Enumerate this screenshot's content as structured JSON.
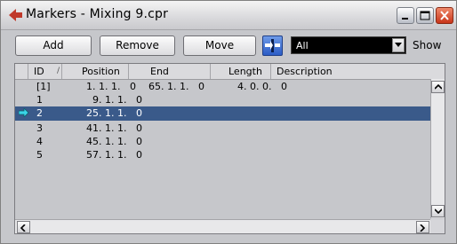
{
  "window": {
    "title": "Markers - Mixing 9.cpr"
  },
  "toolbar": {
    "add_label": "Add",
    "remove_label": "Remove",
    "move_label": "Move",
    "filter_value": "All",
    "show_label": "Show"
  },
  "columns": {
    "id": "ID",
    "position": "Position",
    "end": "End",
    "length": "Length",
    "description": "Description"
  },
  "rows": [
    {
      "id": "[1]",
      "position": "1. 1. 1.   0",
      "end": "65. 1. 1.   0",
      "length": "4. 0. 0.   0",
      "selected": false
    },
    {
      "id": "1",
      "position": "9. 1. 1.   0",
      "end": "",
      "length": "",
      "selected": false
    },
    {
      "id": "2",
      "position": "25. 1. 1.   0",
      "end": "",
      "length": "",
      "selected": true
    },
    {
      "id": "3",
      "position": "41. 1. 1.   0",
      "end": "",
      "length": "",
      "selected": false
    },
    {
      "id": "4",
      "position": "45. 1. 1.   0",
      "end": "",
      "length": "",
      "selected": false
    },
    {
      "id": "5",
      "position": "57. 1. 1.   0",
      "end": "",
      "length": "",
      "selected": false
    }
  ],
  "icons": {
    "app": "cubase-arrow-icon",
    "pointer": "current-marker-arrow-icon",
    "cycle": "cycle-marker-toggle-icon"
  },
  "colors": {
    "selection": "#3a5a8a",
    "pointer": "#3ad4e8",
    "app_icon": "#c0392b"
  }
}
